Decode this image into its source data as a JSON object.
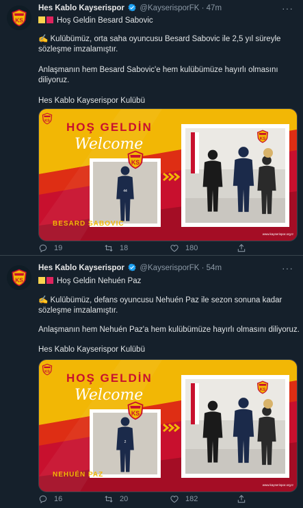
{
  "tweets": [
    {
      "name": "Hes Kablo Kayserispor",
      "handle": "@KayserisporFK",
      "time": "47m",
      "title_text": "Hoş Geldin Besard Sabovic",
      "body_line1": "✍️ Kulübümüz, orta saha oyuncusu Besard Sabovic ile 2,5 yıl süreyle",
      "body_line2": "sözleşme imzalamıştır.",
      "body_line3": "Anlaşmanın hem Besard Sabovic'e hem kulübümüze hayırlı olmasını",
      "body_line4": "diliyoruz.",
      "signature": "Hes Kablo Kayserispor Kulübü",
      "media": {
        "headline": "HOŞ GELDİN",
        "script": "Welcome",
        "player_name": "BESARD SABOVIC",
        "logo_text": "KS",
        "jersey_number": "44",
        "website": "www.kayserispor.org.tr"
      },
      "reply_count": "19",
      "retweet_count": "18",
      "like_count": "180"
    },
    {
      "name": "Hes Kablo Kayserispor",
      "handle": "@KayserisporFK",
      "time": "54m",
      "title_text": "Hoş Geldin Nehuén Paz",
      "body_line1": "✍️ Kulübümüz, defans oyuncusu Nehuén Paz ile sezon sonuna kadar",
      "body_line2": "sözleşme imzalamıştır.",
      "body_line3": "Anlaşmanın hem Nehuén Paz'a hem kulübümüze hayırlı olmasını diliyoruz.",
      "signature": "Hes Kablo Kayserispor Kulübü",
      "media": {
        "headline": "HOŞ GELDİN",
        "script": "Welcome",
        "player_name": "NEHUÉN PAZ",
        "logo_text": "KS",
        "jersey_number": "2",
        "website": "www.kayserispor.org.tr"
      },
      "reply_count": "16",
      "retweet_count": "20",
      "like_count": "182"
    }
  ],
  "colors": {
    "background": "#15202b",
    "secondary_text": "#8b98a5",
    "verified": "#1da1f2",
    "banner_yellow": "#f2b705",
    "banner_red": "#c8102e"
  }
}
